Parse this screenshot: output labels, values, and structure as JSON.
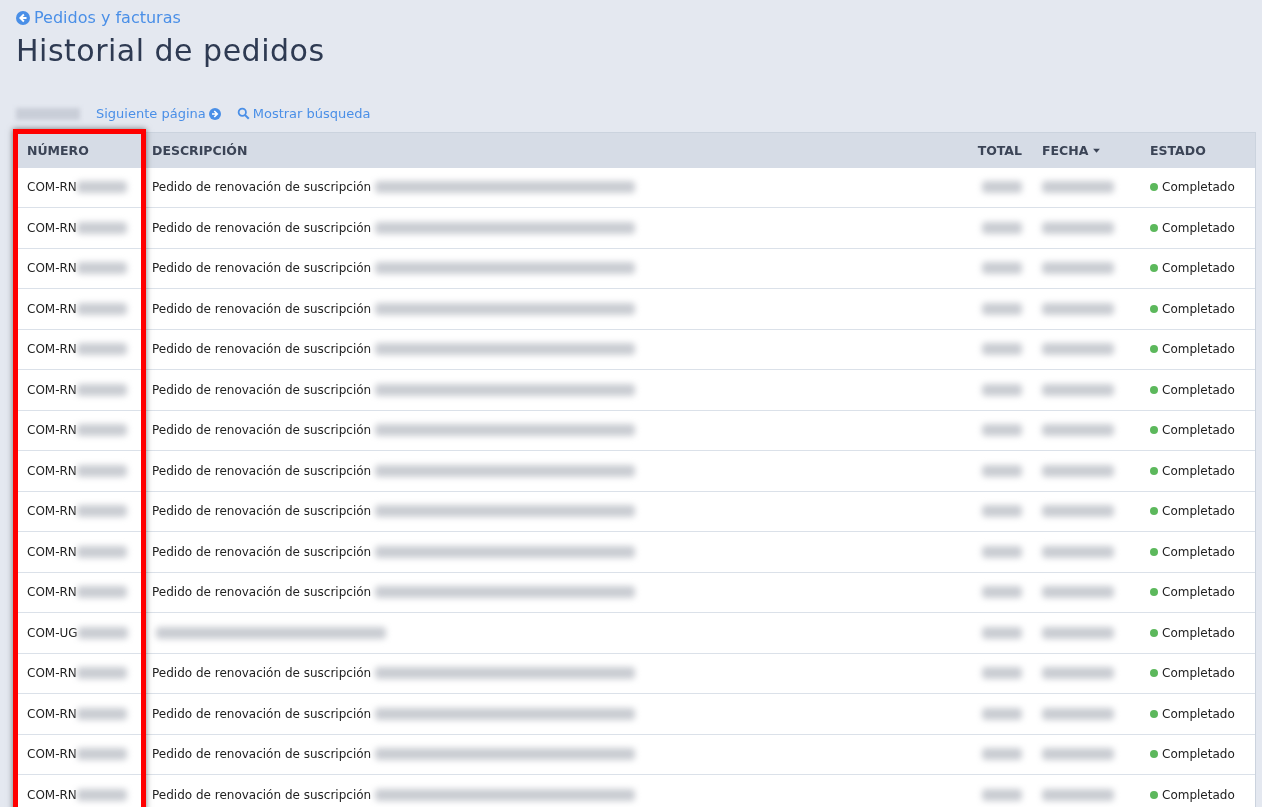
{
  "back_link": {
    "label": "Pedidos y facturas"
  },
  "title": "Historial de pedidos",
  "toolbar": {
    "previous_redacted": true,
    "next_label": "Siguiente página",
    "search_label": "Mostrar búsqueda"
  },
  "table": {
    "columns": [
      {
        "label": "NÚMERO",
        "highlighted": true
      },
      {
        "label": "DESCRIPCIÓN"
      },
      {
        "label": "TOTAL"
      },
      {
        "label": "FECHA",
        "sorted": true
      },
      {
        "label": "ESTADO"
      }
    ],
    "rows": [
      {
        "number": "COM-RN",
        "description": "Pedido de renovación de suscripción",
        "redacted": true,
        "status": "Completado",
        "color": "#5cb85c"
      },
      {
        "number": "COM-RN",
        "description": "Pedido de renovación de suscripción",
        "redacted": true,
        "status": "Completado",
        "color": "#5cb85c"
      },
      {
        "number": "COM-RN",
        "description": "Pedido de renovación de suscripción",
        "redacted": true,
        "status": "Completado",
        "color": "#5cb85c"
      },
      {
        "number": "COM-RN",
        "description": "Pedido de renovación de suscripción",
        "redacted": true,
        "status": "Completado",
        "color": "#5cb85c"
      },
      {
        "number": "COM-RN",
        "description": "Pedido de renovación de suscripción",
        "redacted": true,
        "status": "Completado",
        "color": "#5cb85c"
      },
      {
        "number": "COM-RN",
        "description": "Pedido de renovación de suscripción",
        "redacted": true,
        "status": "Completado",
        "color": "#5cb85c"
      },
      {
        "number": "COM-RN",
        "description": "Pedido de renovación de suscripción",
        "redacted": true,
        "status": "Completado",
        "color": "#5cb85c"
      },
      {
        "number": "COM-RN",
        "description": "Pedido de renovación de suscripción",
        "redacted": true,
        "status": "Completado",
        "color": "#5cb85c"
      },
      {
        "number": "COM-RN",
        "description": "Pedido de renovación de suscripción",
        "redacted": true,
        "status": "Completado",
        "color": "#5cb85c"
      },
      {
        "number": "COM-RN",
        "description": "Pedido de renovación de suscripción",
        "redacted": true,
        "status": "Completado",
        "color": "#5cb85c"
      },
      {
        "number": "COM-RN",
        "description": "Pedido de renovación de suscripción",
        "redacted": true,
        "status": "Completado",
        "color": "#5cb85c"
      },
      {
        "number": "COM-UG",
        "redacted": true,
        "status": "Completado",
        "color": "#5cb85c"
      },
      {
        "number": "COM-RN",
        "description": "Pedido de renovación de suscripción",
        "redacted": true,
        "status": "Completado",
        "color": "#5cb85c"
      },
      {
        "number": "COM-RN",
        "description": "Pedido de renovación de suscripción",
        "redacted": true,
        "status": "Completado",
        "color": "#5cb85c"
      },
      {
        "number": "COM-RN",
        "description": "Pedido de renovación de suscripción",
        "redacted": true,
        "status": "Completado",
        "color": "#5cb85c"
      },
      {
        "number": "COM-RN",
        "description": "Pedido de renovación de suscripción",
        "redacted": true,
        "status": "Completado",
        "color": "#5cb85c"
      }
    ]
  }
}
